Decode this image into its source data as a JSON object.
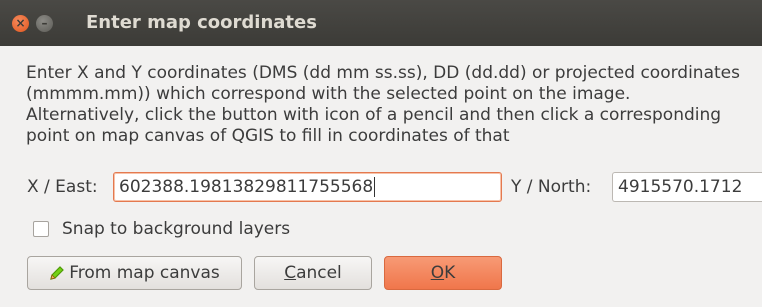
{
  "window": {
    "title": "Enter map coordinates",
    "close_glyph": "×",
    "minimize_glyph": "–"
  },
  "description": "Enter X and Y coordinates (DMS (dd mm ss.ss), DD (dd.dd) or projected coordinates (mmmm.mm)) which correspond with the selected point on the image. Alternatively, click the button with icon of a pencil and then click a corresponding point on map canvas of QGIS to fill in coordinates of that",
  "x_east": {
    "label": "X / East:",
    "value": "602388.19813829811755568"
  },
  "y_north": {
    "label": "Y / North:",
    "value": "4915570.1712"
  },
  "snap": {
    "label": "Snap to background layers",
    "checked": false
  },
  "buttons": {
    "from_map_canvas": "From map canvas",
    "cancel_mnemonic": "C",
    "cancel_rest": "ancel",
    "ok_mnemonic": "O",
    "ok_rest": "K"
  },
  "icons": {
    "pencil": "pencil-icon"
  },
  "colors": {
    "titlebar": "#3c3b37",
    "close_button": "#e0561d",
    "focus_border": "#e4794f",
    "ok_button": "#f0764b",
    "pencil": "#4e9a06"
  }
}
